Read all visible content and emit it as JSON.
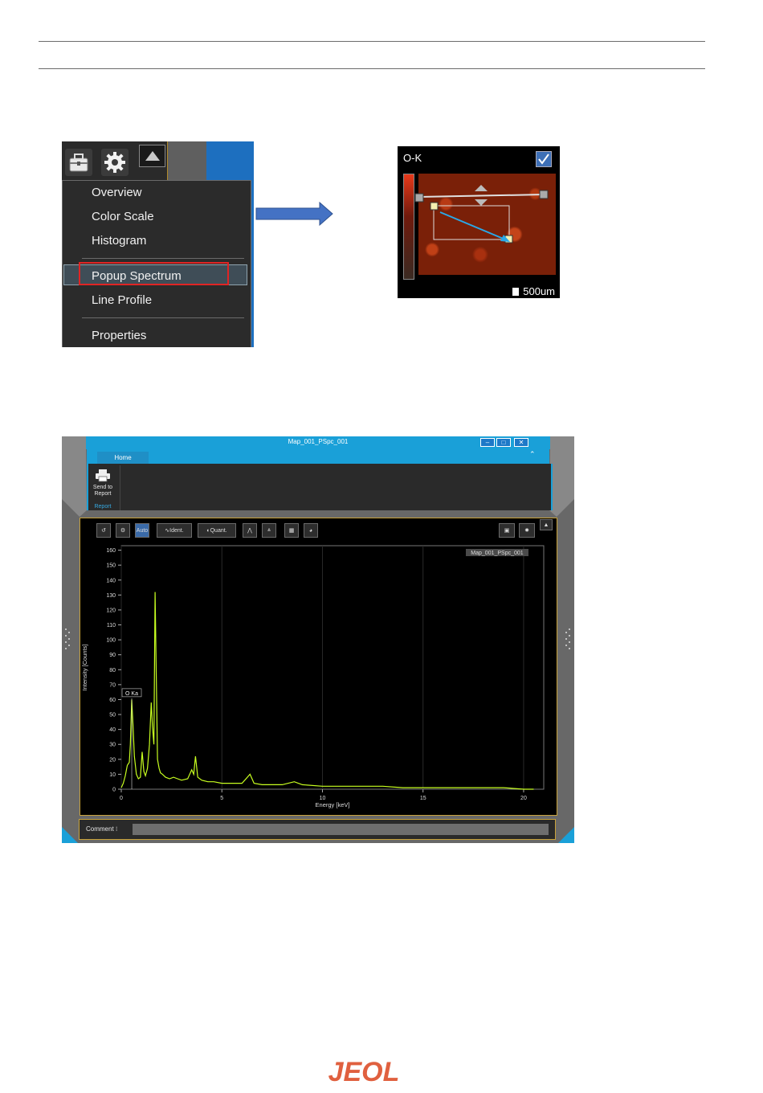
{
  "context_menu": {
    "items": [
      "Overview",
      "Color Scale",
      "Histogram",
      "Popup Spectrum",
      "Line Profile",
      "Properties"
    ],
    "highlighted": "Popup Spectrum",
    "icons": [
      "toolbox-icon",
      "gear-icon",
      "triangle-up-icon"
    ]
  },
  "map": {
    "title": "O-K",
    "scale": "500um",
    "checkbox_checked": true
  },
  "window": {
    "title": "Map_001_PSpc_001",
    "tab": "Home",
    "ribbon_button": "Send to Report",
    "ribbon_group": "Report",
    "ident_label": "Ident.",
    "quant_label": "Quant.",
    "auto_label": "Auto",
    "comment_label": "Comment"
  },
  "chart_data": {
    "type": "line",
    "title": "",
    "legend": "Map_001_PSpc_001",
    "xlabel": "Energy [keV]",
    "ylabel": "Intensity [Counts]",
    "xlim": [
      0,
      21
    ],
    "ylim": [
      0,
      163
    ],
    "xticks": [
      0,
      5,
      10,
      15,
      20
    ],
    "yticks": [
      0,
      10,
      20,
      30,
      40,
      50,
      60,
      70,
      80,
      90,
      100,
      110,
      120,
      130,
      140,
      150,
      160
    ],
    "peak_label": "O Ka",
    "peak_label_x": 0.52,
    "series": [
      {
        "color": "#c8ff20",
        "x": [
          0.0,
          0.1,
          0.2,
          0.3,
          0.4,
          0.45,
          0.52,
          0.58,
          0.65,
          0.75,
          0.85,
          0.95,
          1.04,
          1.12,
          1.2,
          1.3,
          1.4,
          1.49,
          1.55,
          1.62,
          1.68,
          1.74,
          1.8,
          1.88,
          1.95,
          2.05,
          2.2,
          2.4,
          2.6,
          2.8,
          3.0,
          3.3,
          3.5,
          3.6,
          3.69,
          3.8,
          4.0,
          4.3,
          4.6,
          5.0,
          5.5,
          6.0,
          6.4,
          6.6,
          7.0,
          7.5,
          8.0,
          8.6,
          9.0,
          10.0,
          11.0,
          12.0,
          13.0,
          14.0,
          15.0,
          16.0,
          17.0,
          18.0,
          19.0,
          20.0,
          20.5
        ],
        "y": [
          1,
          4,
          9,
          16,
          18,
          30,
          60,
          44,
          22,
          10,
          7,
          8,
          25,
          12,
          9,
          14,
          30,
          58,
          42,
          30,
          132,
          75,
          20,
          14,
          11,
          10,
          8,
          7,
          8,
          7,
          6,
          7,
          13,
          10,
          22,
          8,
          6,
          5,
          5,
          4,
          4,
          4,
          10,
          4,
          3,
          3,
          3,
          5,
          3,
          2,
          2,
          2,
          2,
          1,
          1,
          1,
          1,
          1,
          1,
          0,
          0
        ]
      }
    ]
  }
}
